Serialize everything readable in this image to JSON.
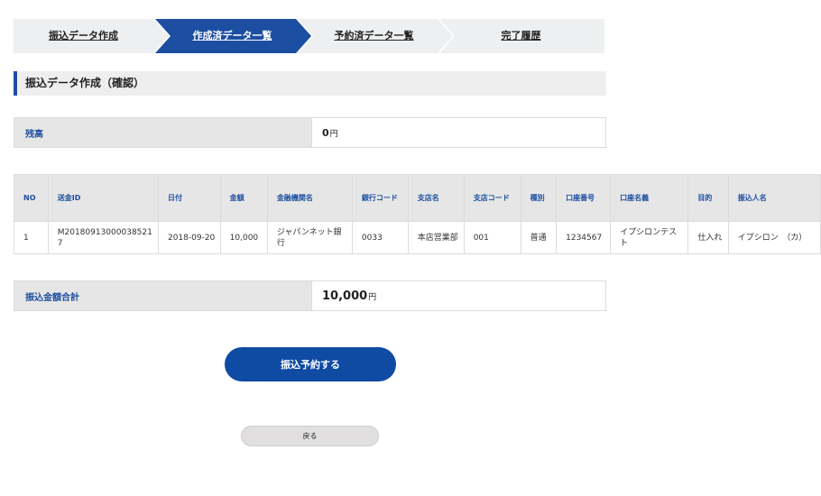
{
  "steps": [
    {
      "label": "振込データ作成",
      "active": false
    },
    {
      "label": "作成済データ一覧",
      "active": true
    },
    {
      "label": "予約済データ一覧",
      "active": false
    },
    {
      "label": "完了履歴",
      "active": false
    }
  ],
  "section_title": "振込データ作成（確認）",
  "balance": {
    "label": "残高",
    "value": "0",
    "unit": "円"
  },
  "table": {
    "headers": {
      "no": "NO",
      "remit_id": "送金ID",
      "date": "日付",
      "amount": "金額",
      "bank": "金融機関名",
      "bank_code": "銀行コード",
      "branch": "支店名",
      "branch_code": "支店コード",
      "type": "種別",
      "account_no": "口座番号",
      "account_name": "口座名義",
      "purpose": "目的",
      "payer": "振込人名"
    },
    "rows": [
      {
        "no": "1",
        "remit_id": "M201809130000385217",
        "date": "2018-09-20",
        "amount": "10,000",
        "bank": "ジャパンネット銀行",
        "bank_code": "0033",
        "branch": "本店営業部",
        "branch_code": "001",
        "type": "普通",
        "account_no": "1234567",
        "account_name": "イプシロンテスト",
        "purpose": "仕入れ",
        "payer": "イプシロン　（カ）"
      }
    ]
  },
  "total": {
    "label": "振込金額合計",
    "value": "10,000",
    "unit": "円"
  },
  "buttons": {
    "reserve": "振込予約する",
    "back": "戻る"
  },
  "colors": {
    "accent": "#1c4ea1",
    "step_inactive": "#eeeff0",
    "button_primary": "#0f4aa3"
  }
}
